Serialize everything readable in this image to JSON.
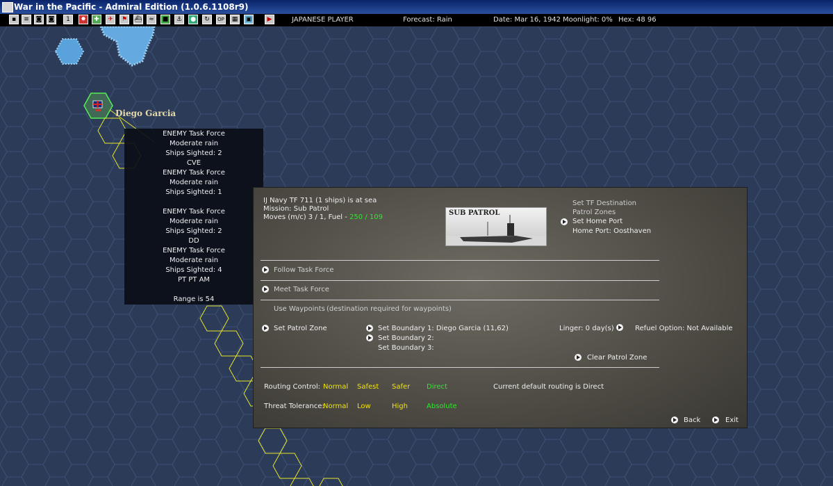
{
  "window": {
    "title": "War in the Pacific - Admiral Edition (1.0.6.1108r9)"
  },
  "toolbar": {
    "player": "JAPANESE PLAYER",
    "forecast": "Forecast: Rain",
    "date": "Date: Mar 16, 1942",
    "moonlight": "Moonlight: 0%",
    "hex": "Hex: 48 96"
  },
  "map": {
    "base_label": "Diego Garcia"
  },
  "tooltip": {
    "lines": [
      "ENEMY Task Force",
      "Moderate rain",
      "Ships Sighted: 2",
      "CVE",
      "ENEMY Task Force",
      "Moderate rain",
      "Ships Sighted: 1",
      "",
      "ENEMY Task Force",
      "Moderate rain",
      "Ships Sighted: 2",
      "DD",
      "ENEMY Task Force",
      "Moderate rain",
      "Ships Sighted: 4",
      "PT PT AM",
      "",
      "Range is 54"
    ]
  },
  "panel": {
    "status": "IJ Navy TF 711 (1 ships) is at sea",
    "mission": "Mission: Sub Patrol",
    "moves_label": "Moves (m/c) 3 / 1, Fuel - ",
    "fuel": "250 / 109",
    "image_caption": "SUB PATROL",
    "set_destination": "Set TF Destination",
    "patrol_zones": "Patrol Zones",
    "set_home_port": "Set Home Port",
    "home_port": "Home Port: Oosthaven",
    "follow_tf": "Follow Task Force",
    "meet_tf": "Meet Task Force",
    "use_waypoints": "Use Waypoints",
    "waypoints_note": "(destination required for waypoints)",
    "set_patrol_zone": "Set Patrol Zone",
    "boundary1": "Set Boundary 1:  Diego Garcia (11,62)",
    "boundary2": "Set Boundary 2:",
    "boundary3": "Set Boundary 3:",
    "linger": "Linger: 0 day(s)",
    "refuel": "Refuel Option:  Not Available",
    "clear_patrol_zone": "Clear Patrol Zone",
    "routing_label": "Routing Control:",
    "routing_options": [
      "Normal",
      "Safest",
      "Safer",
      "Direct"
    ],
    "routing_current": "Current default routing  is  Direct",
    "threat_label": "Threat Tolerance:",
    "threat_options": [
      "Normal",
      "Low",
      "High",
      "Absolute"
    ],
    "back": "Back",
    "exit": "Exit"
  },
  "colors": {
    "map_bg": "#2c3b57",
    "hex_line": "#3d5278",
    "path": "#e6e62a",
    "fuel": "#2bea2b"
  }
}
